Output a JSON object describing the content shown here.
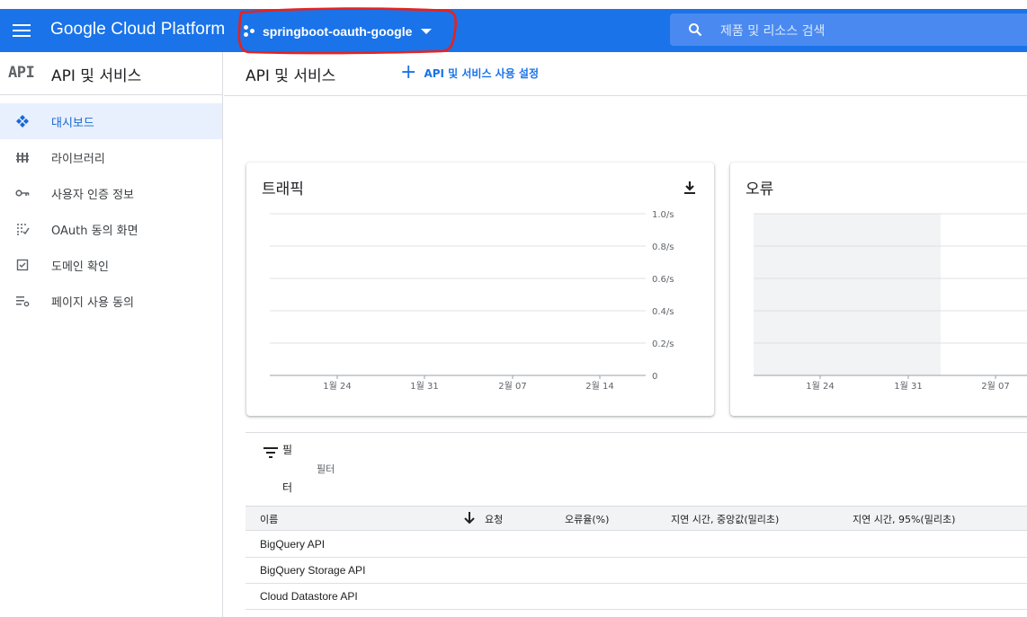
{
  "header": {
    "brand": "Google Cloud Platform",
    "project": "springboot-oauth-google",
    "search_placeholder": "제품 및 리소스 검색",
    "accent": "#1a73e8",
    "annotation_color": "#e8211e"
  },
  "sidebar": {
    "logo": "API",
    "title": "API 및 서비스",
    "items": [
      {
        "label": "대시보드",
        "icon": "dashboard-icon",
        "active": true
      },
      {
        "label": "라이브러리",
        "icon": "library-icon",
        "active": false
      },
      {
        "label": "사용자 인증 정보",
        "icon": "key-icon",
        "active": false
      },
      {
        "label": "OAuth 동의 화면",
        "icon": "consent-icon",
        "active": false
      },
      {
        "label": "도메인 확인",
        "icon": "checkbox-icon",
        "active": false
      },
      {
        "label": "페이지 사용 동의",
        "icon": "settings-list-icon",
        "active": false
      }
    ]
  },
  "main": {
    "title": "API 및 서비스",
    "enable_button": "API 및 서비스 사용 설정"
  },
  "traffic_card": {
    "title": "트래픽",
    "download_icon": "download-icon"
  },
  "errors_card": {
    "title": "오류"
  },
  "chart_data": [
    {
      "type": "line",
      "title": "트래픽",
      "x_ticks": [
        "1월 24",
        "1월 31",
        "2월 07",
        "2월 14"
      ],
      "y_ticks": [
        "0",
        "0.2/s",
        "0.4/s",
        "0.6/s",
        "0.8/s",
        "1.0/s"
      ],
      "ylim": [
        0,
        1.0
      ],
      "series": [],
      "grid": true
    },
    {
      "type": "line",
      "title": "오류",
      "x_ticks": [
        "1월 24",
        "1월 31",
        "2월 07"
      ],
      "series": [],
      "grid": true
    }
  ],
  "filter": {
    "label_part1": "필",
    "label_part2": "터",
    "placeholder": "필터"
  },
  "table": {
    "columns": [
      "이름",
      "요청",
      "오류율(%)",
      "지연 시간, 중앙값(밀리초)",
      "지연 시간, 95%(밀리초)"
    ],
    "rows": [
      "BigQuery API",
      "BigQuery Storage API",
      "Cloud Datastore API"
    ]
  }
}
